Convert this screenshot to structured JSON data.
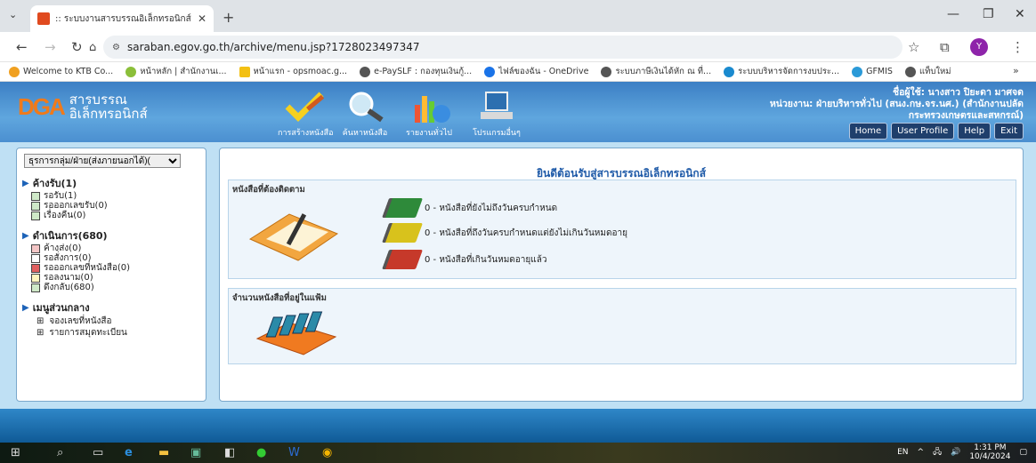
{
  "browser": {
    "tab_title": ":: ระบบงานสารบรรณอิเล็กทรอนิกส์ ::",
    "url": "saraban.egov.go.th/archive/menu.jsp?1728023497347",
    "profile_initial": "Y",
    "bookmarks": [
      {
        "label": "Welcome to KTB Co...",
        "color": "#f0a020"
      },
      {
        "label": "หน้าหลัก | สำนักงานเ...",
        "color": "#8bbf3a"
      },
      {
        "label": "หน้าแรก - opsmoac.g...",
        "color": "#f3c013"
      },
      {
        "label": "e-PaySLF : กองทุนเงินกู้...",
        "color": "#555555"
      },
      {
        "label": "ไฟล์ของฉัน - OneDrive",
        "color": "#1a73e8"
      },
      {
        "label": "ระบบภาษีเงินได้หัก ณ ที่...",
        "color": "#555555"
      },
      {
        "label": "ระบบบริหารจัดการงบประ...",
        "color": "#1a8acf"
      },
      {
        "label": "GFMIS",
        "color": "#2b9ad8"
      },
      {
        "label": "แท็บใหม่",
        "color": "#555555"
      }
    ]
  },
  "header": {
    "logo_text": "DGA",
    "app_name_line1": "สารบรรณ",
    "app_name_line2": "อิเล็กทรอนิกส์",
    "menu": [
      {
        "label": "การสร้างหนังสือ",
        "icon": "pencil-check-icon"
      },
      {
        "label": "ค้นหาหนังสือ",
        "icon": "magnifier-icon"
      },
      {
        "label": "รายงานทั่วไป",
        "icon": "chart-icon"
      },
      {
        "label": "โปรแกรมอื่นๆ",
        "icon": "computer-icon"
      }
    ],
    "user_line": "ชื่อผู้ใช้: นางสาว ปิยะดา มาศจด",
    "unit_line1": "หน่วยงาน: ฝ่ายบริหารทั่วไป (สนง.กษ.จร.นศ.) (สำนักงานปลัด",
    "unit_line2": "กระทรวงเกษตรและสหกรณ์)",
    "buttons": {
      "home": "Home",
      "profile": "User Profile",
      "help": "Help",
      "exit": "Exit"
    }
  },
  "sidebar": {
    "select_value": "ธุรการกลุ่ม/ฝ่าย(ส่งภายนอกได้)(",
    "section1": "ค้างรับ(1)",
    "section1_items": [
      "รอรับ(1)",
      "รอออกเลขรับ(0)",
      "เรื่องคืน(0)"
    ],
    "section2": "ดำเนินการ(680)",
    "section2_items": [
      "ค้างส่ง(0)",
      "รอสั่งการ(0)",
      "รอออกเลขที่หนังสือ(0)",
      "รอลงนาม(0)",
      "ดึงกลับ(680)"
    ],
    "section3": "เมนูส่วนกลาง",
    "section3_items": [
      "จองเลขที่หนังสือ",
      "รายการสมุดทะเบียน"
    ]
  },
  "main": {
    "welcome": "ยินดีต้อนรับสู่สารบรรณอิเล็กทรอนิกส์",
    "panel1_title": "หนังสือที่ต้องติดตาม",
    "status_rows": [
      {
        "text": "0 - หนังสือที่ยังไม่ถึงวันครบกำหนด",
        "color": "#2e8a3a"
      },
      {
        "text": "0 - หนังสือที่ถึงวันครบกำหนดแต่ยังไม่เกินวันหมดอายุ",
        "color": "#d8c21c"
      },
      {
        "text": "0 - หนังสือที่เกินวันหมดอายุแล้ว",
        "color": "#c6392a"
      }
    ],
    "panel2_title": "จำนวนหนังสือที่อยู่ในแฟ้ม"
  },
  "taskbar": {
    "lang": "EN",
    "time": "1:31 PM",
    "date": "10/4/2024"
  }
}
